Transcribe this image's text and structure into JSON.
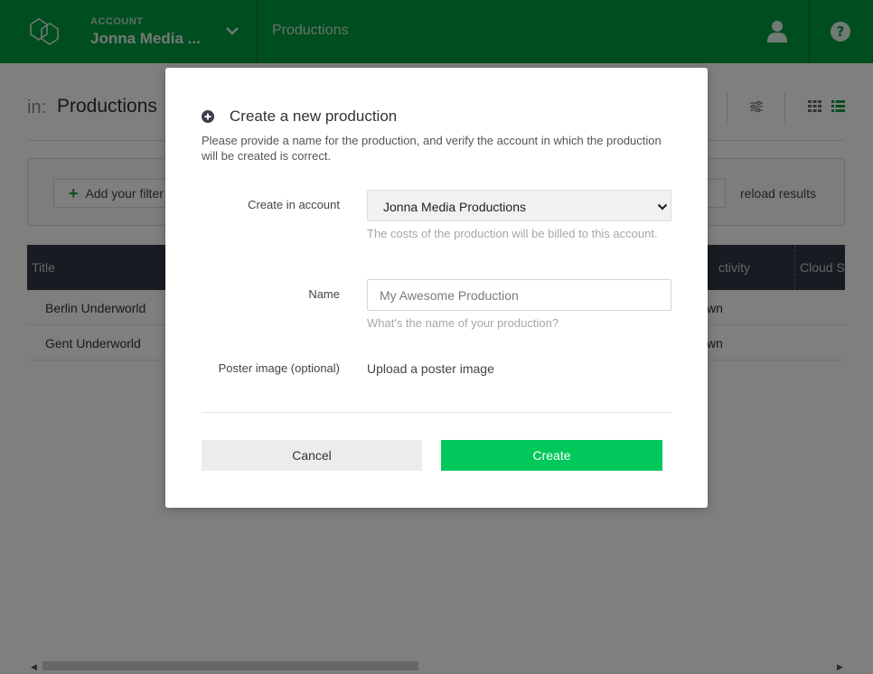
{
  "topbar": {
    "account_label": "ACCOUNT",
    "account_name": "Jonna Media ...",
    "nav_label": "Productions",
    "icons": {
      "logo": "cubes-logo-icon",
      "account_switch": "chevron-down-icon",
      "user": "user-icon",
      "help": "help-circle-icon"
    }
  },
  "page": {
    "in_label": "in:",
    "title": "Productions",
    "filters": {
      "add_filter_label": "Add your filter",
      "reload_label": "reload results"
    },
    "table": {
      "columns": [
        "Title",
        "ctivity",
        "Cloud S"
      ],
      "rows": [
        {
          "title": "Berlin Underworld",
          "activity": "wn"
        },
        {
          "title": "Gent Underworld",
          "activity": "wn"
        }
      ]
    }
  },
  "modal": {
    "title": "Create a new production",
    "description": "Please provide a name for the production, and verify the account in which the production will be created is correct.",
    "account_field": {
      "label": "Create in account",
      "selected": "Jonna Media Productions",
      "help": "The costs of the production will be billed to this account."
    },
    "name_field": {
      "label": "Name",
      "placeholder": "My Awesome Production",
      "help": "What's the name of your production?"
    },
    "poster_field": {
      "label": "Poster image (optional)",
      "link": "Upload a poster image"
    },
    "cancel_label": "Cancel",
    "create_label": "Create",
    "colors": {
      "create": "#00c85a",
      "topbar": "#009a3e",
      "table_header": "#303845"
    }
  }
}
